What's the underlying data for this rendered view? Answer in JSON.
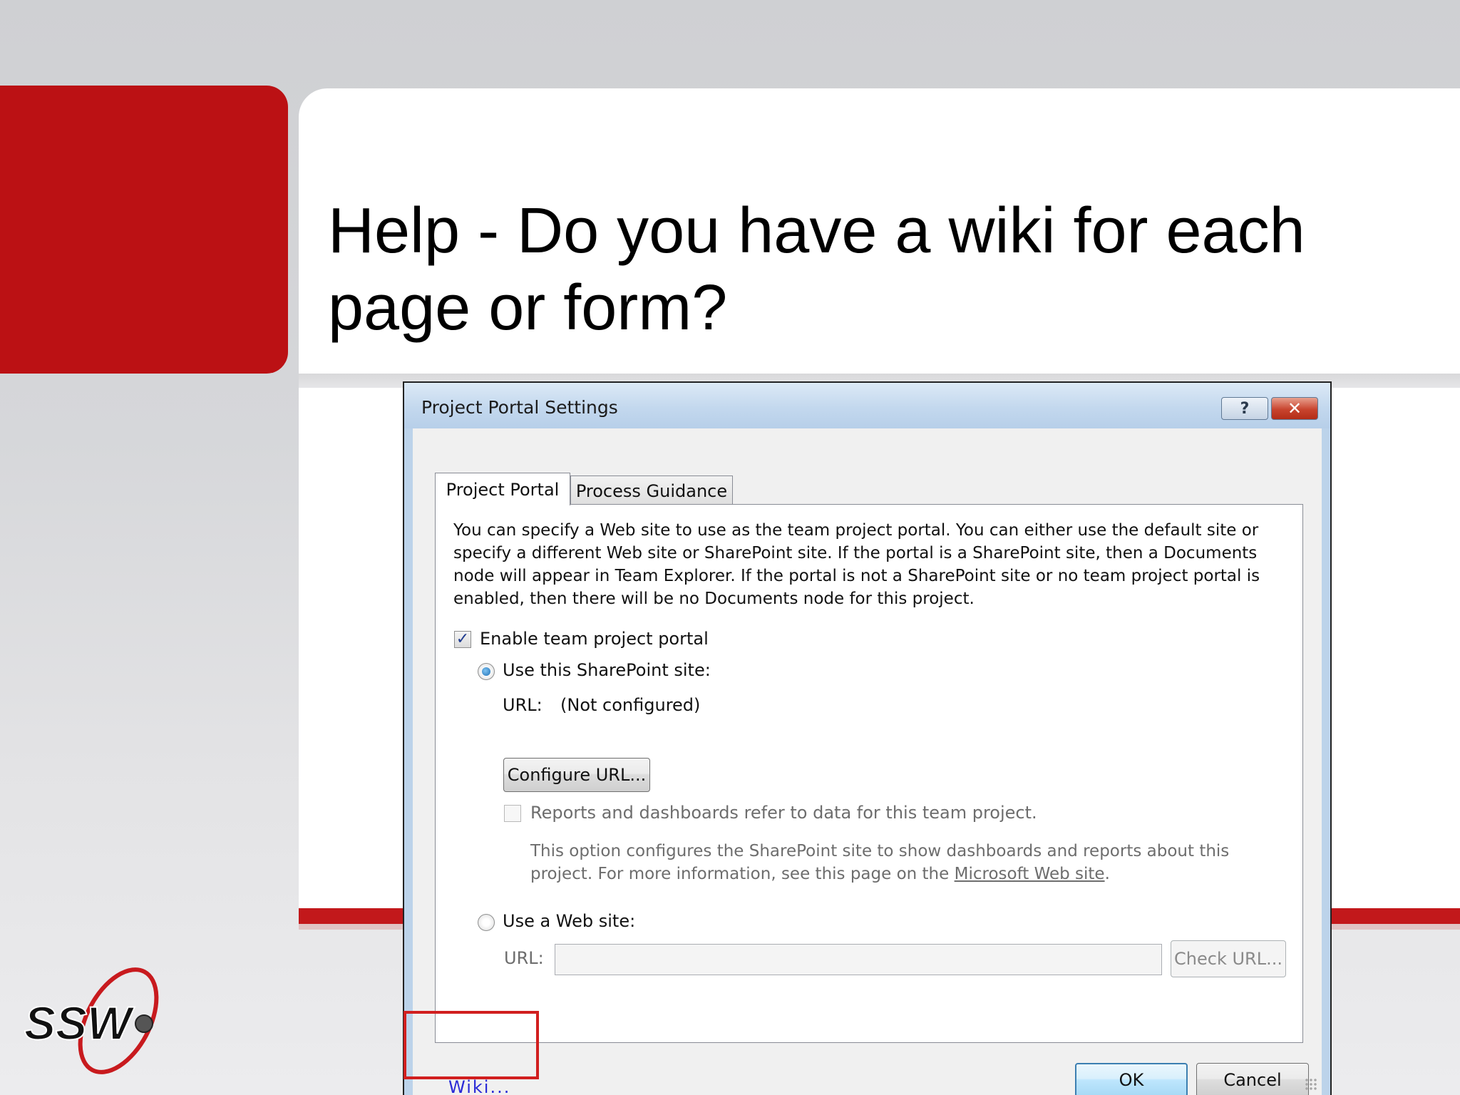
{
  "slide": {
    "title": "Help - Do you have a wiki for each page or form?"
  },
  "logo": {
    "text": "SSW",
    "icon": "ssw-logo-icon"
  },
  "dialog": {
    "title": "Project Portal Settings",
    "help_button": "?",
    "close_button": "✕",
    "tabs": [
      {
        "label": "Project Portal",
        "active": true
      },
      {
        "label": "Process Guidance",
        "active": false
      }
    ],
    "description": "You can specify a Web site to use as the team project portal. You can either use the default site or specify a different Web site or SharePoint site. If the portal is a SharePoint site, then a Documents node will appear in Team Explorer. If the portal is not a SharePoint site or no team project portal is enabled, then there will be no Documents node for this project.",
    "enable_portal": {
      "label": "Enable team project portal",
      "checked": true
    },
    "sharepoint_option": {
      "label": "Use this SharePoint site:",
      "selected": true,
      "url_label": "URL:",
      "url_value": "(Not configured)",
      "configure_button": "Configure URL..."
    },
    "reports_option": {
      "label": "Reports and dashboards refer to data for this team project.",
      "checked": false,
      "enabled": false,
      "note_prefix": "This option configures the SharePoint site to show dashboards and reports about this project. For more information, see this page on the ",
      "note_link": "Microsoft Web site",
      "note_suffix": "."
    },
    "website_option": {
      "label": "Use a Web site:",
      "selected": false,
      "url_label": "URL:",
      "url_value": "",
      "check_button": "Check URL..."
    },
    "wiki_link": "Wiki...",
    "ok_button": "OK",
    "cancel_button": "Cancel"
  },
  "colors": {
    "brand_red": "#bb1114",
    "highlight_red": "#d11f1f",
    "wiki_link": "#2a2ad6"
  }
}
